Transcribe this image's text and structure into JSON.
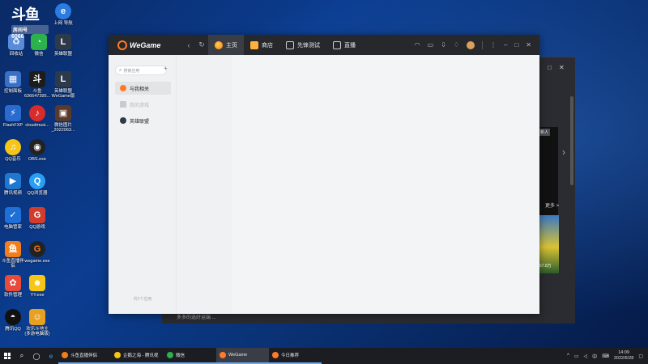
{
  "desktop": {
    "douyu_overlay": {
      "logo": "斗鱼",
      "room_label": "房间号",
      "room_number": "6066"
    },
    "icons": [
      {
        "id": "recycle",
        "label": "回收站",
        "color": "#5a8bd8"
      },
      {
        "id": "wechat",
        "label": "微信",
        "color": "#2bb24c"
      },
      {
        "id": "lol1",
        "label": "英雄联盟",
        "color": "#2d3a4a"
      },
      {
        "id": "control",
        "label": "控制面板",
        "color": "#3a6fc7"
      },
      {
        "id": "douyu",
        "label": "斗鱼 636647395...",
        "color": "#1c1c1c"
      },
      {
        "id": "lol2",
        "label": "英雄联盟 WeGame版",
        "color": "#2d3a4a"
      },
      {
        "id": "flashfxp",
        "label": "FlashFXP",
        "color": "#2a6bd0"
      },
      {
        "id": "cloudmusic",
        "label": "cloudmusi...",
        "color": "#d82b2b"
      },
      {
        "id": "wechat-img",
        "label": "微信图片 _2022063...",
        "color": "#5a3a2a"
      },
      {
        "id": "qqmusic",
        "label": "QQ音乐",
        "color": "#f5c518"
      },
      {
        "id": "obs",
        "label": "OBS.exe",
        "color": "#222222"
      },
      {
        "id": "tencent-video",
        "label": "腾讯视频",
        "color": "#1f77d0"
      },
      {
        "id": "qqbrowser",
        "label": "QQ浏览器",
        "color": "#2a9df4"
      },
      {
        "id": "pcmgr",
        "label": "电脑管家",
        "color": "#1f6fd8"
      },
      {
        "id": "qqgame",
        "label": "QQ游戏",
        "color": "#d23c2c"
      },
      {
        "id": "douyu-live",
        "label": "斗鱼直播伴侣",
        "color": "#f27d1b"
      },
      {
        "id": "wegame-exe",
        "label": "wegame.exe",
        "color": "#222222"
      },
      {
        "id": "softmgr",
        "label": "软件管理",
        "color": "#e84b3c"
      },
      {
        "id": "yy",
        "label": "YY.exe",
        "color": "#f5c518"
      },
      {
        "id": "qq",
        "label": "腾讯QQ",
        "color": "#111111"
      },
      {
        "id": "happy-doudizhu",
        "label": "欢乐斗地主 (多游电脑版)",
        "color": "#e8a020"
      },
      {
        "id": "ie",
        "label": "上网 导航",
        "color": "#2b7be0"
      }
    ]
  },
  "background_window": {
    "more_link": "更多 >",
    "badge": "新人",
    "thumb_caption": "57.8万",
    "bottom_text": "多多的选好运端 ..."
  },
  "wegame": {
    "logo_text": "WeGame",
    "tabs": [
      {
        "label": "主页",
        "icon": "home-icon",
        "active": true
      },
      {
        "label": "商店",
        "icon": "shop-icon",
        "active": false
      },
      {
        "label": "先锋测试",
        "icon": "pioneer-icon",
        "active": false
      },
      {
        "label": "直播",
        "icon": "live-icon",
        "active": false
      }
    ],
    "sidebar": {
      "search_placeholder": "搜索应用",
      "add_label": "+",
      "items": [
        {
          "label": "与我相关",
          "icon": "related-icon",
          "state": "active"
        },
        {
          "label": "我的游戏",
          "icon": "games-icon",
          "state": "dim"
        },
        {
          "label": "英雄联盟",
          "icon": "lol-icon",
          "state": "normal"
        }
      ],
      "footer": "共2个应用"
    }
  },
  "taskbar": {
    "apps": [
      {
        "label": "斗鱼直播伴侣",
        "color": "#f27d1b",
        "active": false
      },
      {
        "label": "企鹅之海 - 腾讯视",
        "color": "#f5c518",
        "active": false
      },
      {
        "label": "微信",
        "color": "#2bb24c",
        "active": false
      },
      {
        "label": "WeGame",
        "color": "#ff7b2a",
        "active": true
      },
      {
        "label": "今日推荐",
        "color": "#ff7b2a",
        "active": false
      }
    ],
    "tray": {
      "ime": "中",
      "time": "14:09",
      "date": "2022/6/28"
    }
  },
  "colors": {
    "accent_orange": "#ff7b2a",
    "titlebar": "#26282c"
  }
}
